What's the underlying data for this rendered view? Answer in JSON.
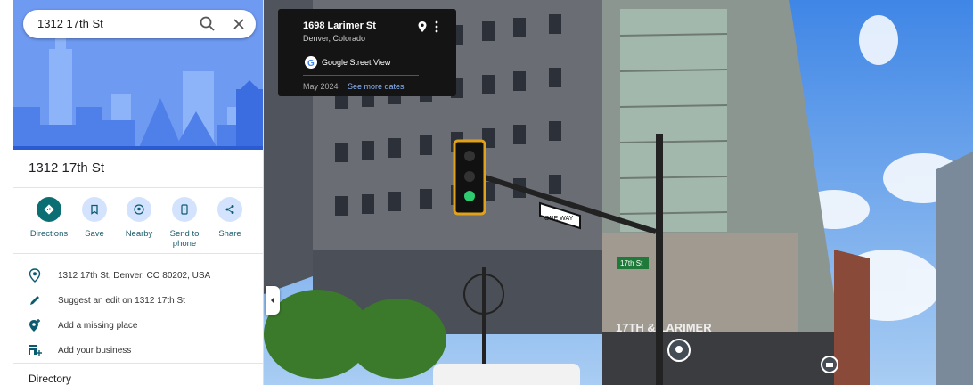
{
  "search": {
    "value": "1312 17th St"
  },
  "place": {
    "title": "1312 17th St"
  },
  "actions": [
    {
      "label": "Directions"
    },
    {
      "label": "Save"
    },
    {
      "label": "Nearby"
    },
    {
      "label": "Send to\nphone"
    },
    {
      "label": "Share"
    }
  ],
  "info": {
    "address": "1312 17th St, Denver, CO 80202, USA",
    "suggest_edit": "Suggest an edit on 1312 17th St",
    "add_place": "Add a missing place",
    "add_business": "Add your business"
  },
  "directory": "Directory",
  "street_view": {
    "address": "1698 Larimer St",
    "city": "Denver, Colorado",
    "brand": "Google Street View",
    "date": "May 2024",
    "see_more": "See more dates",
    "sign_one_way": "ONE WAY",
    "sign_street": "17th St",
    "building_sign": "17TH & LARIMER"
  },
  "colors": {
    "accent": "#0b6e73",
    "action_bg": "#d3e3fd",
    "card_bg": "#141414",
    "link": "#8ab4f8"
  }
}
